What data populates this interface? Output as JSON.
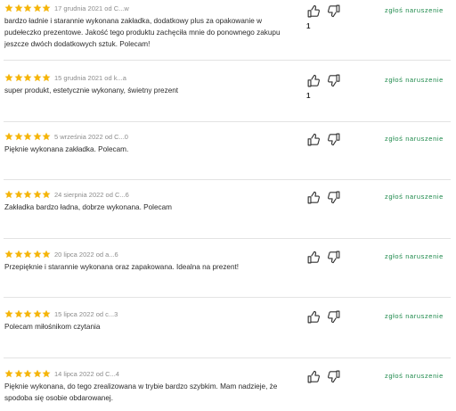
{
  "colors": {
    "star": "#f5b50a",
    "report": "#1f8a4c"
  },
  "icons": {
    "star": "star-icon",
    "like": "thumbs-up-icon",
    "dislike": "thumbs-down-icon"
  },
  "reviews": [
    {
      "rating": 5,
      "meta": "17 grudnia 2021 od C...w",
      "text": "bardzo ładnie i starannie wykonana zakładka, dodatkowy plus za opakowanie w pudełeczko prezentowe. Jakość tego produktu zachęciła mnie do ponownego zakupu jeszcze dwóch dodatkowych sztuk. Polecam!",
      "likes": "1",
      "report": "zgłoś naruszenie"
    },
    {
      "rating": 5,
      "meta": "15 grudnia 2021 od k...a",
      "text": "super produkt, estetycznie wykonany, świetny prezent",
      "likes": "1",
      "report": "zgłoś naruszenie"
    },
    {
      "rating": 5,
      "meta": "5 września 2022 od C...0",
      "text": "Pięknie wykonana zakładka. Polecam.",
      "likes": "",
      "report": "zgłoś naruszenie"
    },
    {
      "rating": 5,
      "meta": "24 sierpnia 2022 od C...6",
      "text": "Zakładka bardzo ładna, dobrze wykonana. Polecam",
      "likes": "",
      "report": "zgłoś naruszenie"
    },
    {
      "rating": 5,
      "meta": "20 lipca 2022 od a...6",
      "text": "Przepięknie i starannie wykonana oraz zapakowana. Idealna na prezent!",
      "likes": "",
      "report": "zgłoś naruszenie"
    },
    {
      "rating": 5,
      "meta": "15 lipca 2022 od c...3",
      "text": "Polecam miłośnikom czytania",
      "likes": "",
      "report": "zgłoś naruszenie"
    },
    {
      "rating": 5,
      "meta": "14 lipca 2022 od C...4",
      "text": "Pięknie wykonana, do tego zrealizowana w trybie bardzo szybkim. Mam nadzieje, że spodoba się osobie obdarowanej.",
      "likes": "",
      "report": "zgłoś naruszenie"
    }
  ]
}
